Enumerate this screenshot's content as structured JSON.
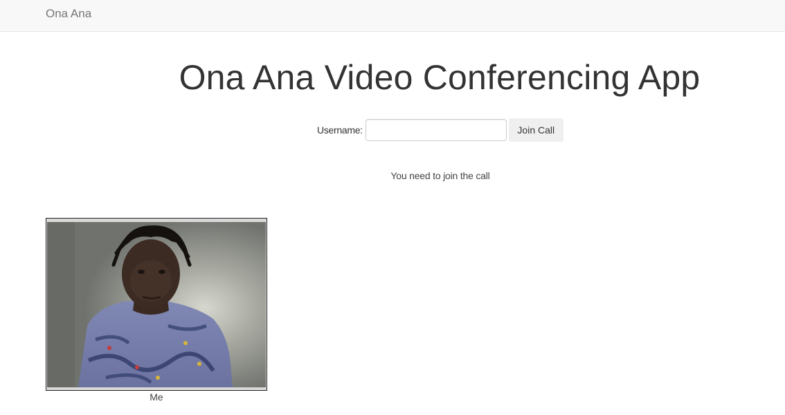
{
  "navbar": {
    "brand": "Ona Ana"
  },
  "main": {
    "title": "Ona Ana Video Conferencing App",
    "form": {
      "username_label": "Username:",
      "username_value": "",
      "username_placeholder": "",
      "join_button_label": "Join Call"
    },
    "status": "You need to join the call"
  },
  "videos": {
    "local": {
      "caption": "Me"
    }
  },
  "colors": {
    "navbar_bg": "#f8f8f8",
    "brand_text": "#777777",
    "button_bg": "#efefef"
  }
}
